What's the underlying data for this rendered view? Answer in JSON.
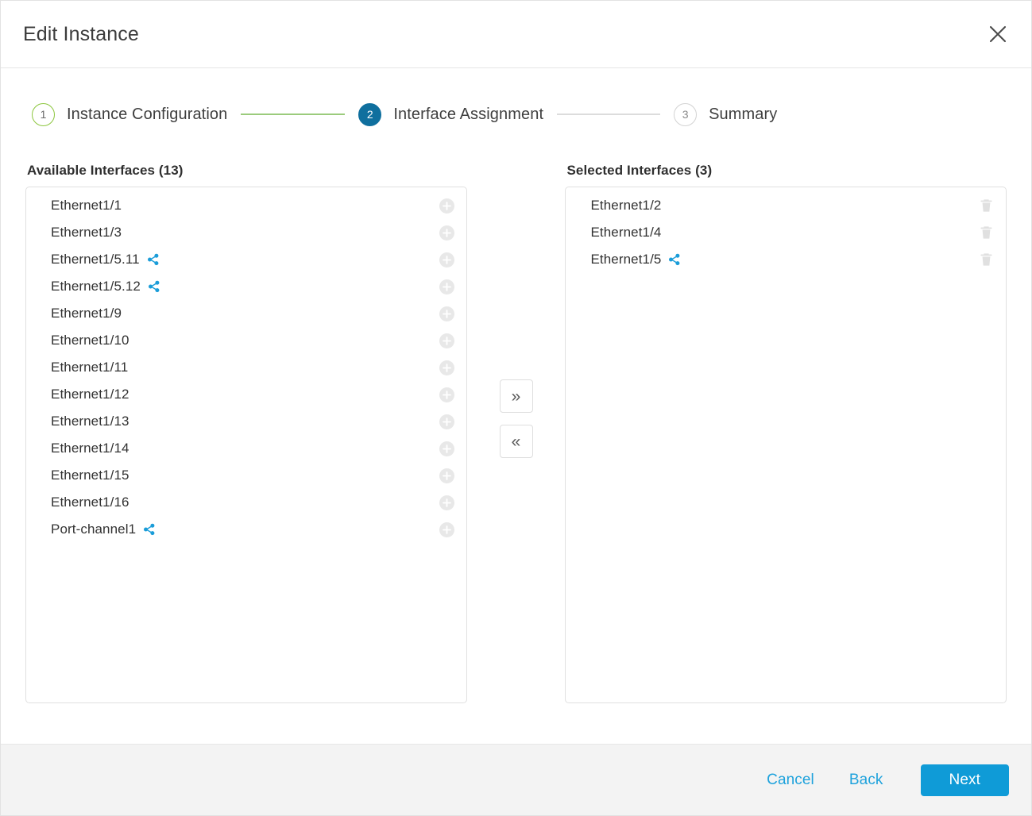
{
  "header": {
    "title": "Edit Instance",
    "close_icon": "close-icon"
  },
  "stepper": {
    "steps": [
      {
        "number": "1",
        "label": "Instance Configuration",
        "state": "done"
      },
      {
        "number": "2",
        "label": "Interface Assignment",
        "state": "active"
      },
      {
        "number": "3",
        "label": "Summary",
        "state": "todo"
      }
    ]
  },
  "available": {
    "title": "Available Interfaces (13)",
    "count": 13,
    "action_icon": "plus-circle-icon",
    "items": [
      {
        "name": "Ethernet1/1",
        "shared": false
      },
      {
        "name": "Ethernet1/3",
        "shared": false
      },
      {
        "name": "Ethernet1/5.11",
        "shared": true
      },
      {
        "name": "Ethernet1/5.12",
        "shared": true
      },
      {
        "name": "Ethernet1/9",
        "shared": false
      },
      {
        "name": "Ethernet1/10",
        "shared": false
      },
      {
        "name": "Ethernet1/11",
        "shared": false
      },
      {
        "name": "Ethernet1/12",
        "shared": false
      },
      {
        "name": "Ethernet1/13",
        "shared": false
      },
      {
        "name": "Ethernet1/14",
        "shared": false
      },
      {
        "name": "Ethernet1/15",
        "shared": false
      },
      {
        "name": "Ethernet1/16",
        "shared": false
      },
      {
        "name": "Port-channel1",
        "shared": true
      }
    ]
  },
  "selected": {
    "title": "Selected Interfaces (3)",
    "count": 3,
    "action_icon": "trash-icon",
    "items": [
      {
        "name": "Ethernet1/2",
        "shared": false
      },
      {
        "name": "Ethernet1/4",
        "shared": false
      },
      {
        "name": "Ethernet1/5",
        "shared": true
      }
    ]
  },
  "transfer": {
    "add_all_label": "»",
    "remove_all_label": "«",
    "add_all_icon": "chevron-double-right-icon",
    "remove_all_icon": "chevron-double-left-icon"
  },
  "footer": {
    "cancel_label": "Cancel",
    "back_label": "Back",
    "next_label": "Next"
  },
  "colors": {
    "accent_blue": "#0f9bd7",
    "link_blue": "#1ea2dc",
    "step_active": "#0f6f9e",
    "step_done_green": "#8dc63f",
    "share_icon_blue": "#1b9dd9",
    "footer_bg": "#f3f3f3"
  }
}
